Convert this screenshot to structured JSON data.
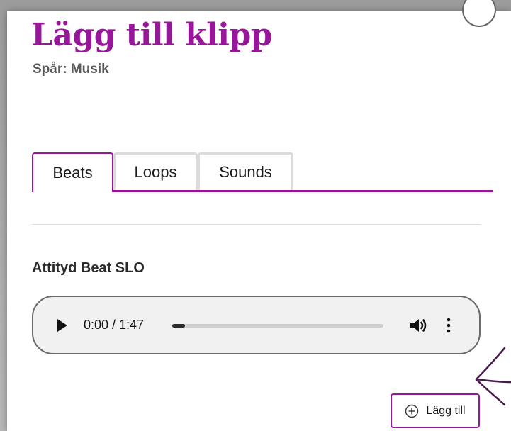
{
  "dialog": {
    "title": "Lägg till klipp",
    "subtitle": "Spår: Musik"
  },
  "tabs": [
    {
      "label": "Beats",
      "active": true
    },
    {
      "label": "Loops",
      "active": false
    },
    {
      "label": "Sounds",
      "active": false
    }
  ],
  "clip": {
    "title": "Attityd Beat SLO",
    "player": {
      "time_display": "0:00 / 1:47",
      "progress": 0.06,
      "icons": [
        "play-icon",
        "volume-icon",
        "more-vertical-icon"
      ]
    }
  },
  "add_button": {
    "label": "Lägg till",
    "icon": "plus-circle-icon"
  },
  "annotation": {
    "icon": "hand-drawn-arrow-icon",
    "color": "#4a1a4d"
  },
  "colors": {
    "accent": "#98169a",
    "subtitle": "#5a5a5a",
    "tab_border_inactive": "#dcdcdc",
    "player_bg": "#f1f1f1"
  }
}
